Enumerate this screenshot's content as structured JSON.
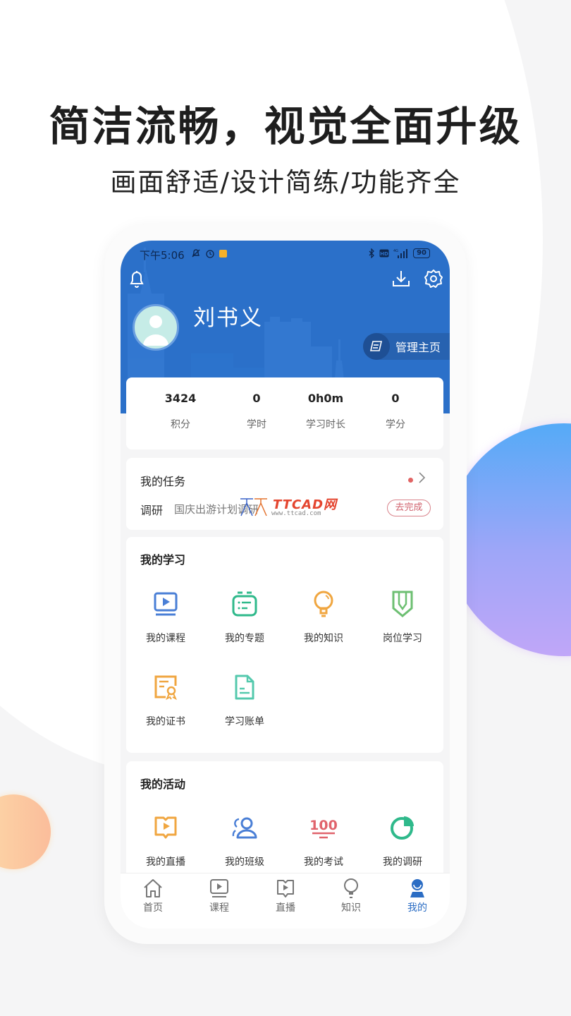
{
  "promo": {
    "headline": "简洁流畅，视觉全面升级",
    "subline": "画面舒适/设计简练/功能齐全"
  },
  "status_bar": {
    "time": "下午5:06",
    "network": "4G",
    "battery": "90"
  },
  "header": {
    "user_name": "刘书义",
    "manage_label": "管理主页",
    "brand_color": "#2b70c9"
  },
  "stats": [
    {
      "value": "3424",
      "label": "积分"
    },
    {
      "value": "0",
      "label": "学时"
    },
    {
      "value": "0h0m",
      "label": "学习时长"
    },
    {
      "value": "0",
      "label": "学分"
    }
  ],
  "tasks": {
    "title": "我的任务",
    "item_type": "调研",
    "item_name": "国庆出游计划调研",
    "action_label": "去完成",
    "watermark_brand": "TTCAD网",
    "watermark_url": "www.ttcad.com"
  },
  "learning": {
    "title": "我的学习",
    "items": [
      {
        "label": "我的课程",
        "icon": "course-play-icon",
        "color": "#4a7fd6"
      },
      {
        "label": "我的专题",
        "icon": "topic-list-icon",
        "color": "#2fb98b"
      },
      {
        "label": "我的知识",
        "icon": "lightbulb-icon",
        "color": "#f0a640"
      },
      {
        "label": "岗位学习",
        "icon": "pencil-badge-icon",
        "color": "#6dbf72"
      },
      {
        "label": "我的证书",
        "icon": "certificate-icon",
        "color": "#f0a640"
      },
      {
        "label": "学习账单",
        "icon": "document-icon",
        "color": "#54c9ad"
      }
    ]
  },
  "activities": {
    "title": "我的活动",
    "items": [
      {
        "label": "我的直播",
        "icon": "live-book-icon",
        "color": "#f0a640"
      },
      {
        "label": "我的班级",
        "icon": "class-users-icon",
        "color": "#4a7fd6"
      },
      {
        "label": "我的考试",
        "icon": "exam-100-icon",
        "color": "#e0636c"
      },
      {
        "label": "我的调研",
        "icon": "survey-pie-icon",
        "color": "#2fb98b"
      }
    ]
  },
  "tabbar": {
    "items": [
      {
        "label": "首页",
        "icon": "home-icon",
        "active": false
      },
      {
        "label": "课程",
        "icon": "course-icon",
        "active": false
      },
      {
        "label": "直播",
        "icon": "live-icon",
        "active": false
      },
      {
        "label": "知识",
        "icon": "knowledge-icon",
        "active": false
      },
      {
        "label": "我的",
        "icon": "profile-icon",
        "active": true
      }
    ],
    "active_color": "#2b6dc4"
  }
}
